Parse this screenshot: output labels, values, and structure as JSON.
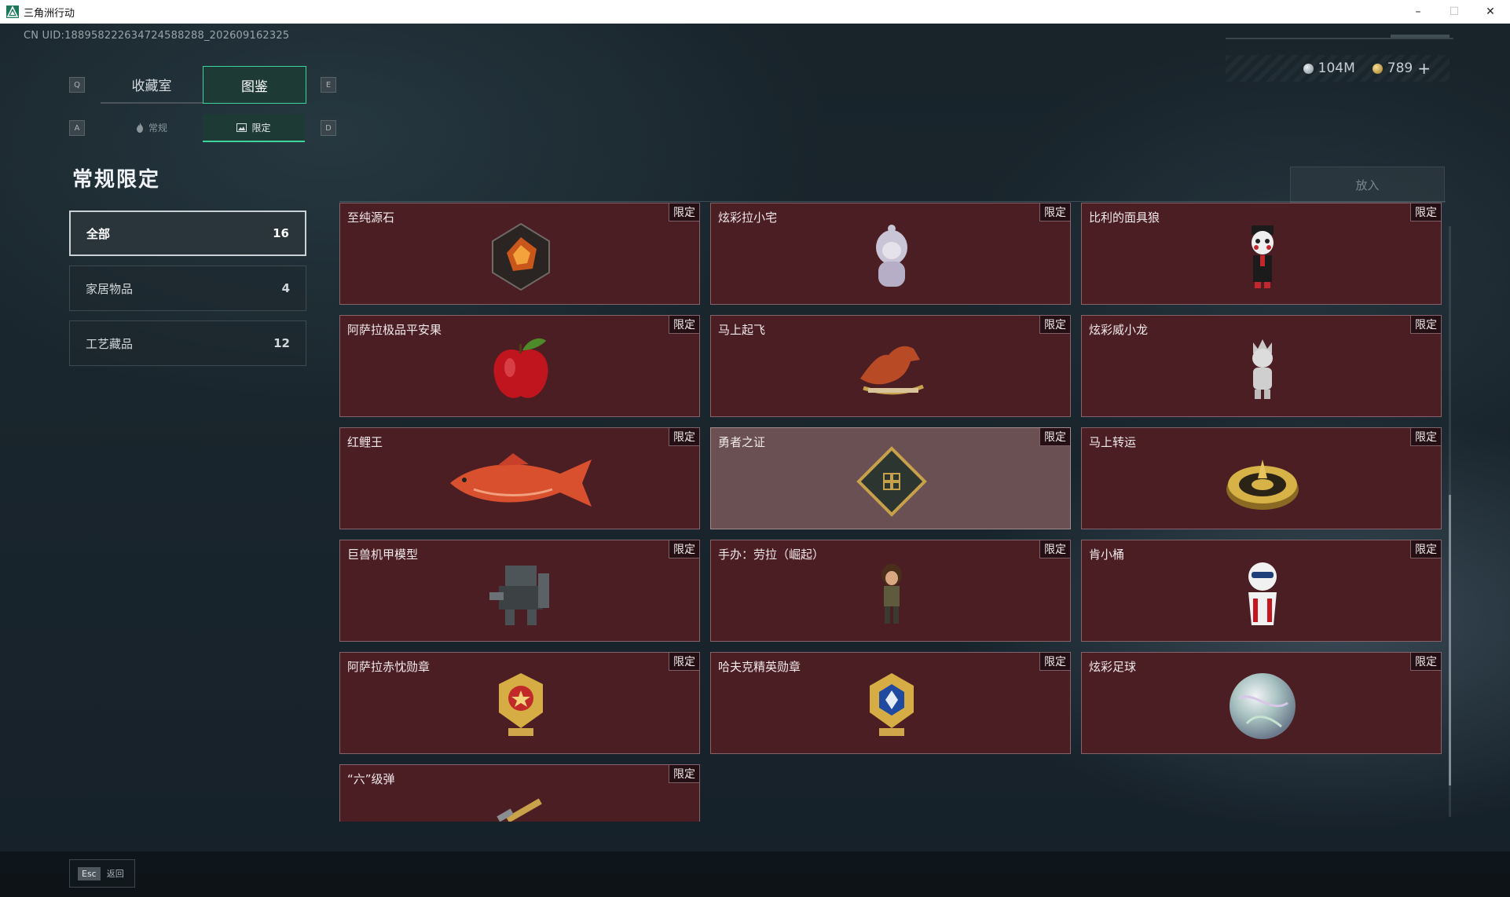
{
  "window": {
    "title": "三角洲行动",
    "minimize": "–",
    "maximize": "☐",
    "close": "✕"
  },
  "uid": "CN UID:1889582226347245882​88_202609162325",
  "currency": {
    "silver": "104M",
    "gold": "789",
    "add": "+"
  },
  "tabs": {
    "left_key": "Q",
    "right_key": "E",
    "items": [
      {
        "label": "收藏室"
      },
      {
        "label": "图鉴"
      }
    ],
    "active_index": 1
  },
  "subtabs": {
    "left_key": "A",
    "right_key": "D",
    "items": [
      {
        "label": "常规",
        "icon": "flame-icon"
      },
      {
        "label": "限定",
        "icon": "picture-icon"
      }
    ],
    "active_index": 1
  },
  "page_title": "常规限定",
  "put_button": "放入",
  "categories": [
    {
      "label": "全部",
      "count": "16"
    },
    {
      "label": "家居物品",
      "count": "4"
    },
    {
      "label": "工艺藏品",
      "count": "12"
    }
  ],
  "active_category_index": 0,
  "limited_tag": "限定",
  "items": [
    {
      "name": "至纯源石",
      "icon": "crystal-stone-icon"
    },
    {
      "name": "炫彩拉小宅",
      "icon": "hooded-figure-icon"
    },
    {
      "name": "比利的面具狼",
      "icon": "puppet-figure-icon"
    },
    {
      "name": "阿萨拉极品平安果",
      "icon": "apple-icon"
    },
    {
      "name": "马上起飞",
      "icon": "horse-statue-icon"
    },
    {
      "name": "炫彩威小龙",
      "icon": "dragon-figure-icon"
    },
    {
      "name": "红鲤王",
      "icon": "carp-fish-icon"
    },
    {
      "name": "勇者之证",
      "icon": "badge-card-icon"
    },
    {
      "name": "马上转运",
      "icon": "golden-compass-icon"
    },
    {
      "name": "巨兽机甲模型",
      "icon": "mech-model-icon"
    },
    {
      "name": "手办：劳拉（崛起）",
      "icon": "lara-figure-icon"
    },
    {
      "name": "肯小桶",
      "icon": "bucket-figure-icon"
    },
    {
      "name": "阿萨拉赤忱勋章",
      "icon": "red-medal-icon"
    },
    {
      "name": "哈夫克精英勋章",
      "icon": "blue-medal-icon"
    },
    {
      "name": "炫彩足球",
      "icon": "football-icon"
    },
    {
      "name": "“六”级弹",
      "icon": "bullet-icon"
    }
  ],
  "highlighted_item_index": 7,
  "back": {
    "key": "Esc",
    "label": "返回"
  },
  "colors": {
    "accent": "#3cd69d",
    "card_bg": "#4b1e23",
    "card_border": "#85636a"
  }
}
